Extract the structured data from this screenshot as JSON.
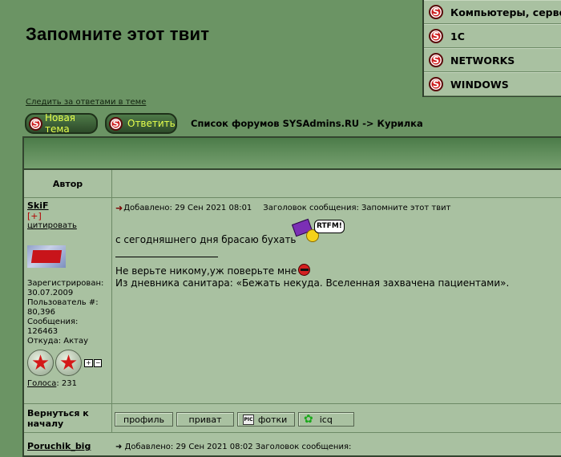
{
  "page_title": "Запомните этот твит",
  "category_menu": [
    {
      "label": "Компьютеры, серве",
      "icon": "s-logo-icon"
    },
    {
      "label": "1C",
      "icon": "s-logo-icon"
    },
    {
      "label": "NETWORKS",
      "icon": "s-logo-icon"
    },
    {
      "label": "WINDOWS",
      "icon": "s-logo-icon"
    }
  ],
  "watch_link": "Следить за ответами в теме",
  "buttons": {
    "new_topic": "Новая тема",
    "reply": "Ответить",
    "logo_letter": "S"
  },
  "breadcrumb": "Список форумов SYSAdmins.RU -> Курилка",
  "table": {
    "author_header": "Автор"
  },
  "post": {
    "author": "SkiF",
    "plus": "[+]",
    "quote": "цитировать",
    "registered_label": "Зарегистрирован:",
    "registered_value": "30.07.2009",
    "user_no_label": "Пользователь #:",
    "user_no_value": "80,396",
    "messages_label": "Сообщения:",
    "messages_value": "126463",
    "location": "Откуда: Актау",
    "votes_label": "Голоса",
    "votes_value": ": 231",
    "star_glyph": "★",
    "tiny_plus": "+",
    "tiny_minus": "−",
    "posted_label": "Добавлено: 29 Сен 2021 08:01",
    "subject_label": "Заголовок сообщения: Запомните этот твит",
    "body_line1": "с сегодняшнего дня брасаю бухать",
    "rtfm": "RTFM!",
    "sig_line1": "Не верьте никому,уж поверьте мне",
    "sig_line2": "Из дневника санитара: «Бежать некуда. Вселенная захвачена пациентами».",
    "arrow_glyph": "➜"
  },
  "back_to_top": "Вернуться к началу",
  "profile_buttons": {
    "profile": "профиль",
    "private": "приват",
    "photos": "фотки",
    "photos_icon_text": "PIC",
    "icq": "icq",
    "icq_glyph": "✿"
  },
  "next_post": {
    "author": "Poruchik_big",
    "meta": "➜ Добавлено: 29 Сен 2021 08:02    Заголовок сообщения:"
  }
}
